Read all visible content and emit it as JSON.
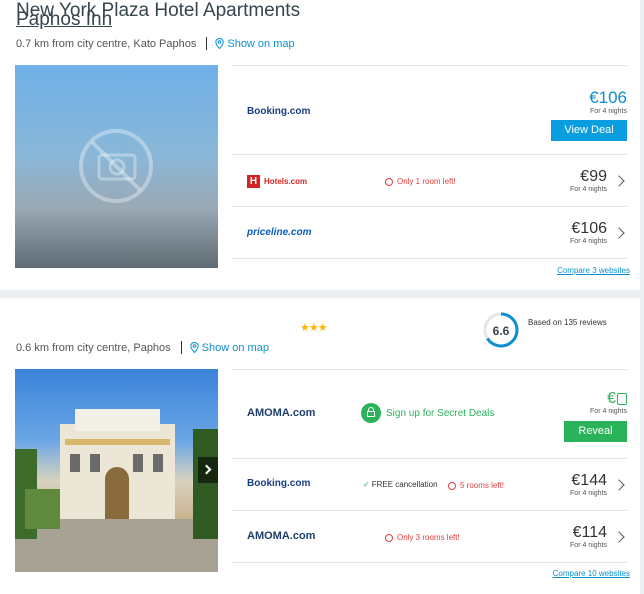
{
  "hotels": [
    {
      "name": "Paphos Inn",
      "distance": "0.7 km from city centre, Kato Paphos",
      "map_link": "Show on map",
      "deals": [
        {
          "provider": "Booking.com",
          "price": "€106",
          "nights": "For 4 nights",
          "button": "View Deal"
        },
        {
          "provider": "Hotels.com",
          "price": "€99",
          "nights": "For 4 nights",
          "warning": "Only 1 room left!"
        },
        {
          "provider": "priceline.com",
          "price": "€106",
          "nights": "For 4 nights"
        }
      ],
      "compare": "Compare 3 websites"
    },
    {
      "name": "New York Plaza Hotel Apartments",
      "stars": 3,
      "rating": "6.6",
      "rating_fraction": 0.66,
      "reviews": "Based on 135 reviews",
      "distance": "0.6 km from city centre, Paphos",
      "map_link": "Show on map",
      "deals": [
        {
          "provider": "AMOMA.com",
          "price": "€",
          "nights": "For 4 nights",
          "button": "Reveal",
          "promo": "Sign up for Secret Deals"
        },
        {
          "provider": "Booking.com",
          "price": "€144",
          "nights": "For 4 nights",
          "free_cancel": "FREE cancellation",
          "warning": "5 rooms left!"
        },
        {
          "provider": "AMOMA.com",
          "price": "€114",
          "nights": "For 4 nights",
          "warning": "Only 3 rooms left!"
        }
      ],
      "compare": "Compare 10 websites"
    }
  ],
  "colors": {
    "accent": "#0a8fd0",
    "green": "#2bb35a",
    "warning": "#e04040",
    "star": "#f5b800"
  }
}
